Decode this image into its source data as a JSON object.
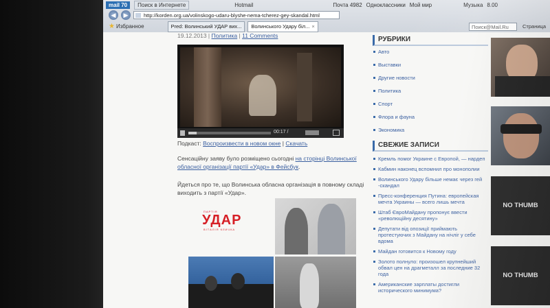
{
  "browser": {
    "top_bar": {
      "brand": "mail 70",
      "search_tab": "Поиск в Интернете",
      "hotmail": "Hotmail",
      "mail_count": "Почта 4982",
      "yandex": "Одноклассники",
      "mymail": "Мой мир",
      "music": "Музыка",
      "news_count": "8.00"
    },
    "url": "http://korden.org.ua/volinskogo-udaru-blyshe-nema-tcherez-gey-skandal.html",
    "favorites_label": "Избранное",
    "tabs": [
      {
        "label": "Pred: Волинський УДАР вих...",
        "active": false
      },
      {
        "label": "Волинського Удару біл...",
        "active": true
      }
    ],
    "search_placeholder": "Поиск@Mail.Ru",
    "page_label": "Страница"
  },
  "article": {
    "date": "19.12.2013",
    "separator": "|",
    "category": "Политика",
    "comments": "11 Comments",
    "video": {
      "time": "00:17 / ",
      "progress": 0.1
    },
    "podcast_label": "Подкаст:",
    "podcast_play": "Воспроизвести в новом окне",
    "podcast_sep": "|",
    "podcast_download": "Скачать",
    "para1_text": "Сенсаційну заяву було розміщено сьогодні ",
    "para1_link": "на сторінці Волинської обласної організації партії «Удар» в Фейсбук",
    "para1_end": ".",
    "para2": "Йдеться про те, що Волинська обласна організація в повному складі виходить з партії «Удар».",
    "logo": {
      "top": "ПАРТІЯ",
      "main": "УДАР",
      "sub": "ВІТАЛІЯ КЛИЧКА"
    }
  },
  "sidebar": {
    "rubrics_title": "РУБРИКИ",
    "rubrics": [
      "Авто",
      "Выставки",
      "Другие новости",
      "Политика",
      "Спорт",
      "Флора и фауна",
      "Экономика"
    ],
    "recent_title": "СВЕЖИЕ ЗАПИСИ",
    "recent": [
      "Кремль помог Украине с Европой, — нардеп",
      "Кабмин наконец вспомнил про монополии",
      "Волинського Удару більше немає через гей -скандал",
      "Пресс-конференция Путина: европейская мечта Украины — всего лишь мечта",
      "Штаб ЄвроМайдану пропонує ввести «революційну десятину»",
      "Депутати від опозиції приймають протестуючих з Майдану на нічліг у себе вдома",
      "Майдан готовится к Новому году",
      "Золото полнуло: произошел крупнейший обвал цен на драгметалл за последние 32 года",
      "Американские зарплаты достигли исторического минимума?"
    ]
  },
  "thumbs": {
    "no_thumb_1": "NO THUMB",
    "no_thumb_2": "NO THUMB"
  }
}
